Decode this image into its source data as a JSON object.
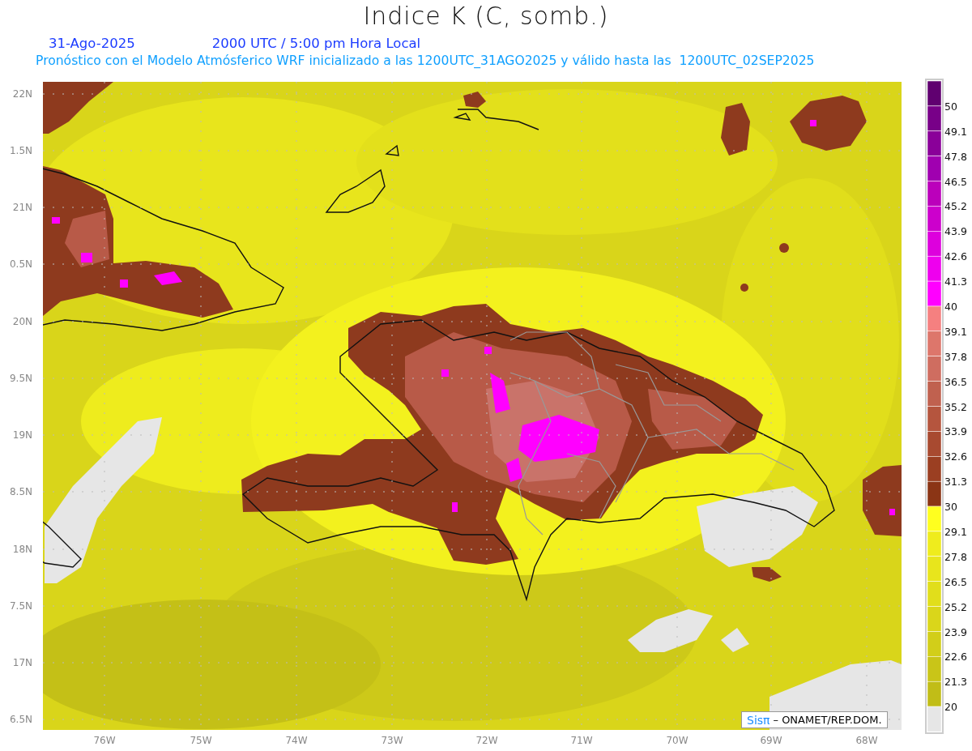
{
  "title": "Indice K (C, somb.)",
  "date": "31-Ago-2025",
  "time": "2000 UTC / 5:00 pm Hora Local",
  "subtitle": "Pronóstico con el Modelo Atmósferico WRF inicializado a las 1200UTC_31AGO2025 y válido hasta las  1200UTC_02SEP2025",
  "map": {
    "y_axis_labels": [
      "22N",
      "1.5N",
      "21N",
      "0.5N",
      "20N",
      "9.5N",
      "19N",
      "8.5N",
      "18N",
      "7.5N",
      "17N",
      "6.5N"
    ],
    "x_axis_labels": [
      "76W",
      "75W",
      "74W",
      "73W",
      "72W",
      "71W",
      "70W",
      "69W",
      "68W"
    ]
  },
  "legend": {
    "bins": [
      {
        "color": "#600070"
      },
      {
        "color": "#780088"
      },
      {
        "color": "#8a0099"
      },
      {
        "color": "#a000b0"
      },
      {
        "color": "#bb00bb"
      },
      {
        "color": "#cc00cc"
      },
      {
        "color": "#dd00dd"
      },
      {
        "color": "#ee00ee"
      },
      {
        "color": "#ff00ff"
      },
      {
        "color": "#f58080"
      },
      {
        "color": "#dd766b"
      },
      {
        "color": "#cf6d60"
      },
      {
        "color": "#c0614f"
      },
      {
        "color": "#b5553e"
      },
      {
        "color": "#a84a30"
      },
      {
        "color": "#9b3f22"
      },
      {
        "color": "#8b3515"
      },
      {
        "color": "#ffff1f"
      },
      {
        "color": "#efec1d"
      },
      {
        "color": "#e8e51c"
      },
      {
        "color": "#e1de1b"
      },
      {
        "color": "#dad61a"
      },
      {
        "color": "#d2ce19"
      },
      {
        "color": "#c9c518"
      },
      {
        "color": "#c1bd17"
      },
      {
        "color": "#e6e6e6"
      }
    ],
    "labels": [
      "50",
      "49.1",
      "47.8",
      "46.5",
      "45.2",
      "43.9",
      "42.6",
      "41.3",
      "40",
      "39.1",
      "37.8",
      "36.5",
      "35.2",
      "33.9",
      "32.6",
      "31.3",
      "30",
      "29.1",
      "27.8",
      "26.5",
      "25.2",
      "23.9",
      "22.6",
      "21.3",
      "20"
    ]
  },
  "credit": {
    "brand": "Sisπ",
    "text": "– ONAMET/REP.DOM."
  }
}
